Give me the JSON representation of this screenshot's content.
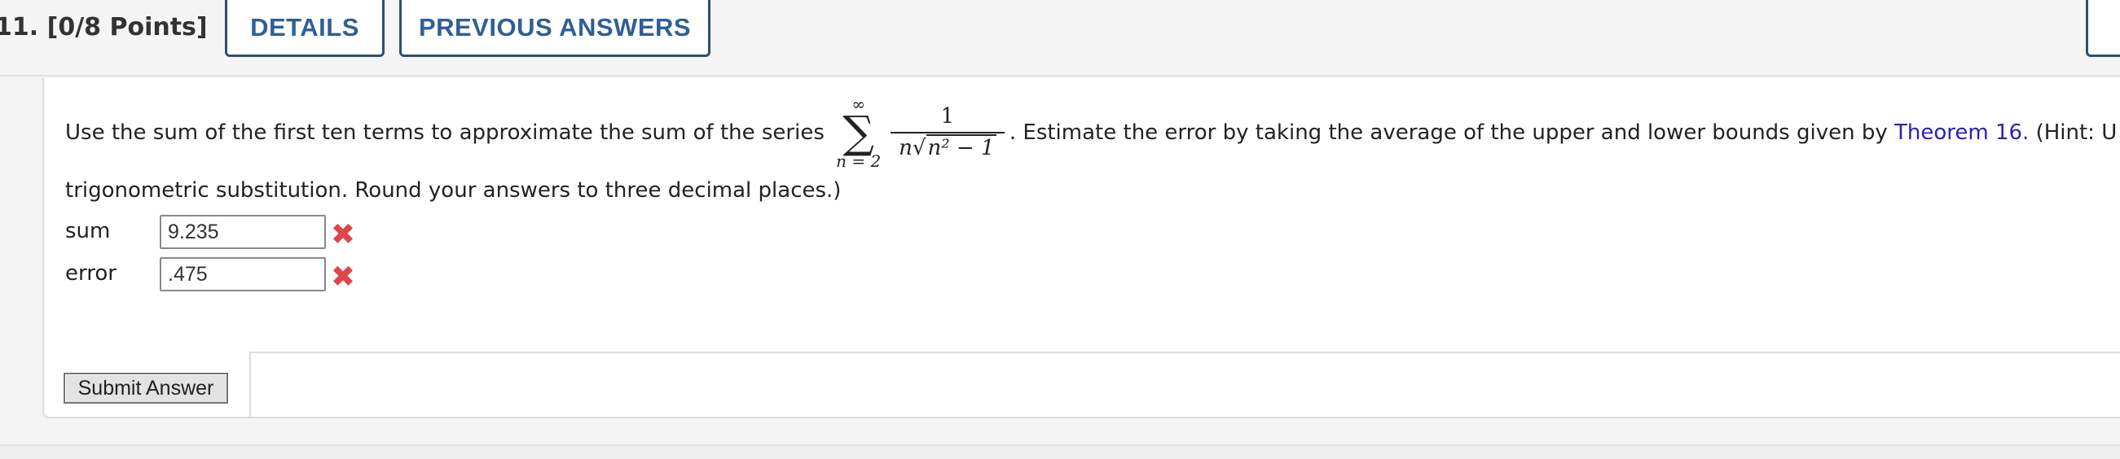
{
  "header": {
    "question_number": "11.",
    "points": "[0/8 Points]",
    "details_label": "DETAILS",
    "previous_answers_label": "PREVIOUS ANSWERS"
  },
  "question": {
    "text_before": "Use the sum of the first ten terms to approximate the sum of the series",
    "series": {
      "upper": "∞",
      "sigma": "∑",
      "lower": "n = 2",
      "numerator": "1",
      "denominator_n": "n",
      "radicand": "n² − 1"
    },
    "text_after": ". Estimate the error by taking the average of the upper and lower bounds given by",
    "link_text": "Theorem 16.",
    "text_hint": "(Hint: U",
    "text_line2": "trigonometric substitution. Round your answers to three decimal places.)"
  },
  "answers": {
    "sum_label": "sum",
    "sum_value": "9.235",
    "sum_status": "incorrect",
    "error_label": "error",
    "error_value": ".475",
    "error_status": "incorrect"
  },
  "submit": {
    "label": "Submit Answer"
  },
  "colors": {
    "accent": "#2f5f96",
    "link": "#2a1fbf",
    "incorrect": "#e0454a"
  },
  "icons": {
    "incorrect": "x-mark-icon"
  }
}
